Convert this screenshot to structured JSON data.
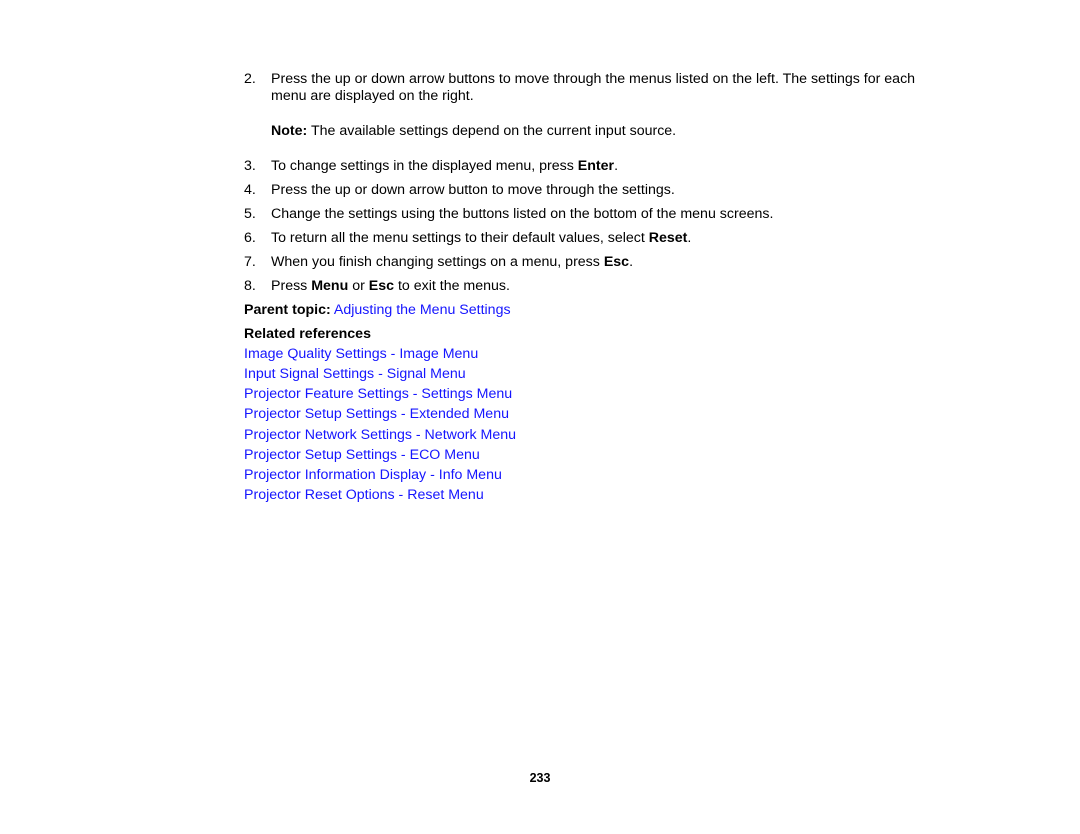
{
  "steps": [
    {
      "num": "2.",
      "parts": [
        "Press the up or down arrow buttons to move through the menus listed on the left. The settings for each menu are displayed on the right."
      ]
    },
    {
      "num": "3.",
      "pre": "To change settings in the displayed menu, press ",
      "bold": "Enter",
      "post": "."
    },
    {
      "num": "4.",
      "text": "Press the up or down arrow button to move through the settings."
    },
    {
      "num": "5.",
      "text": "Change the settings using the buttons listed on the bottom of the menu screens."
    },
    {
      "num": "6.",
      "pre": "To return all the menu settings to their default values, select ",
      "bold": "Reset",
      "post": "."
    },
    {
      "num": "7.",
      "pre": "When you finish changing settings on a menu, press ",
      "bold": "Esc",
      "post": "."
    },
    {
      "num": "8.",
      "pre": "Press ",
      "bold": "Menu",
      "mid": " or ",
      "bold2": "Esc",
      "post": " to exit the menus."
    }
  ],
  "note": {
    "label": "Note:",
    "text": " The available settings depend on the current input source."
  },
  "parent_topic": {
    "label": "Parent topic:",
    "link": "Adjusting the Menu Settings"
  },
  "related": {
    "heading": "Related references",
    "links": [
      "Image Quality Settings - Image Menu",
      "Input Signal Settings - Signal Menu",
      "Projector Feature Settings - Settings Menu",
      "Projector Setup Settings - Extended Menu",
      "Projector Network Settings - Network Menu",
      "Projector Setup Settings - ECO Menu",
      "Projector Information Display - Info Menu",
      "Projector Reset Options - Reset Menu"
    ]
  },
  "page_number": "233",
  "colors": {
    "link": "#1515ff",
    "text": "#000000"
  }
}
